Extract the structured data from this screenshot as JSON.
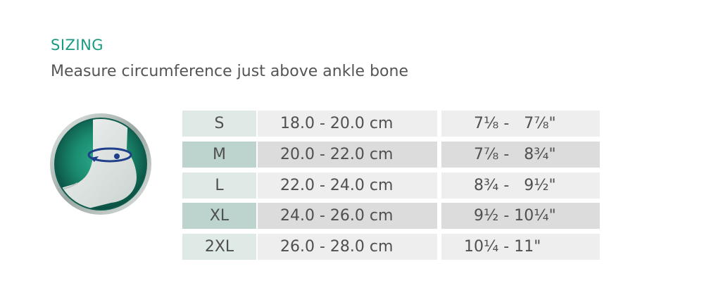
{
  "heading": {
    "title": "SIZING",
    "subtitle": "Measure circumference just above ankle bone"
  },
  "illustration": {
    "icon": "ankle-measure-icon",
    "colors": {
      "ring": "#0e6a58",
      "accent": "#1a9a82",
      "arrow": "#1f3f8a"
    }
  },
  "size_table": {
    "colors": {
      "label_cell_alt1": "#dfe9e6",
      "label_cell_alt2": "#bcd4cd",
      "value_cell_alt1": "#eeeeee",
      "value_cell_alt2": "#dcdcdc"
    },
    "rows": [
      {
        "size": "S",
        "cm": "18.0 - 20.0 cm",
        "inches": "7⅛ -   7⅞\""
      },
      {
        "size": "M",
        "cm": "20.0 - 22.0 cm",
        "inches": "7⅞ -   8¾\""
      },
      {
        "size": "L",
        "cm": "22.0 - 24.0 cm",
        "inches": "8¾ -   9½\""
      },
      {
        "size": "XL",
        "cm": "24.0 - 26.0 cm",
        "inches": "9½ - 10¼\""
      },
      {
        "size": "2XL",
        "cm": "26.0 - 28.0 cm",
        "inches": "10¼ - 11\""
      }
    ]
  }
}
